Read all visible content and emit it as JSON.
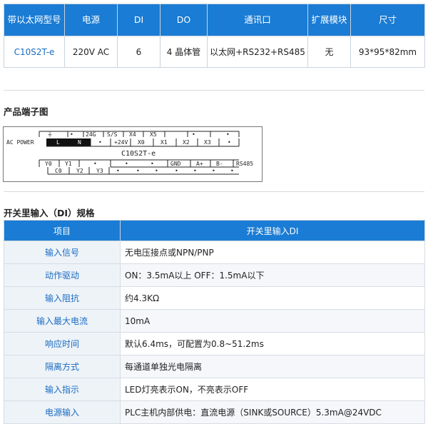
{
  "spec": {
    "headers": [
      "带以太网型号",
      "电源",
      "DI",
      "DO",
      "通讯口",
      "扩展模块",
      "尺寸"
    ],
    "row": [
      "C10S2T-e",
      "220V AC",
      "6",
      "4 晶体管",
      "以太网+RS232+RS485",
      "无",
      "93*95*82mm"
    ]
  },
  "terminal": {
    "title": "产品端子图",
    "top_row": [
      "⏚",
      "•",
      "24G",
      "S/S",
      "X4",
      "X5",
      "•",
      "•"
    ],
    "ac_power": "AC POWER",
    "top_row2": [
      "L",
      "N",
      "•",
      "+24V",
      "X0",
      "X1",
      "X2",
      "X3",
      "•"
    ],
    "model": "C10S2T-e",
    "bot_row1": [
      "Y0",
      "Y1",
      "•",
      "•",
      "•",
      "GND",
      "A+",
      "B-"
    ],
    "rs485": "RS485",
    "bot_row2": [
      "C0",
      "Y2",
      "Y3",
      "•",
      "•",
      "•",
      "•",
      "•",
      "•",
      "•"
    ]
  },
  "di": {
    "title": "开关里输入（DI）规格",
    "headers": [
      "项目",
      "开关里输入DI"
    ],
    "rows": [
      [
        "输入信号",
        "无电压接点或NPN/PNP"
      ],
      [
        "动作驱动",
        "ON：3.5mA以上  OFF：1.5mA以下"
      ],
      [
        "输入阻抗",
        "约4.3KΩ"
      ],
      [
        "输入最大电流",
        "10mA"
      ],
      [
        "响应时间",
        "默认6.4ms，可配置为0.8~51.2ms"
      ],
      [
        "隔离方式",
        "每通道单独光电隔离"
      ],
      [
        "输入指示",
        "LED灯亮表示ON，不亮表示OFF"
      ],
      [
        "电源输入",
        "PLC主机内部供电：直流电源（SINK或SOURCE）5.3mA@24VDC"
      ]
    ]
  }
}
